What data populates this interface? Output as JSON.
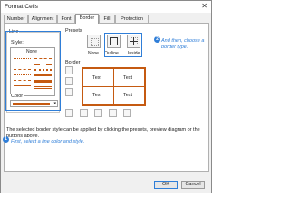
{
  "window": {
    "title": "Format Cells",
    "close_glyph": "✕"
  },
  "tabs": [
    {
      "label": "Number"
    },
    {
      "label": "Alignment"
    },
    {
      "label": "Font"
    },
    {
      "label": "Border",
      "active": true
    },
    {
      "label": "Fill"
    },
    {
      "label": "Protection"
    }
  ],
  "line": {
    "group_label": "Line",
    "style_label": "Style:",
    "none_label": "None",
    "color_label": "Color",
    "selected_color": "#c55a11",
    "dropdown_glyph": "▾"
  },
  "presets": {
    "label": "Presets",
    "items": [
      {
        "label": "None",
        "icon": "preset-none-icon"
      },
      {
        "label": "Outline",
        "icon": "preset-outline-icon"
      },
      {
        "label": "Inside",
        "icon": "preset-inside-icon"
      }
    ]
  },
  "border": {
    "label": "Border",
    "preview_text": [
      "Text",
      "Text",
      "Text",
      "Text"
    ]
  },
  "description": "The selected border style can be applied by clicking the presets, preview diagram or the buttons above.",
  "callouts": [
    {
      "number": "1",
      "text": "First, select a line color and style."
    },
    {
      "number": "2",
      "text": "And then, choose a border type."
    }
  ],
  "buttons": {
    "ok": "OK",
    "cancel": "Cancel"
  },
  "colors": {
    "accent": "#2f7ed8",
    "border_color": "#c55a11"
  }
}
